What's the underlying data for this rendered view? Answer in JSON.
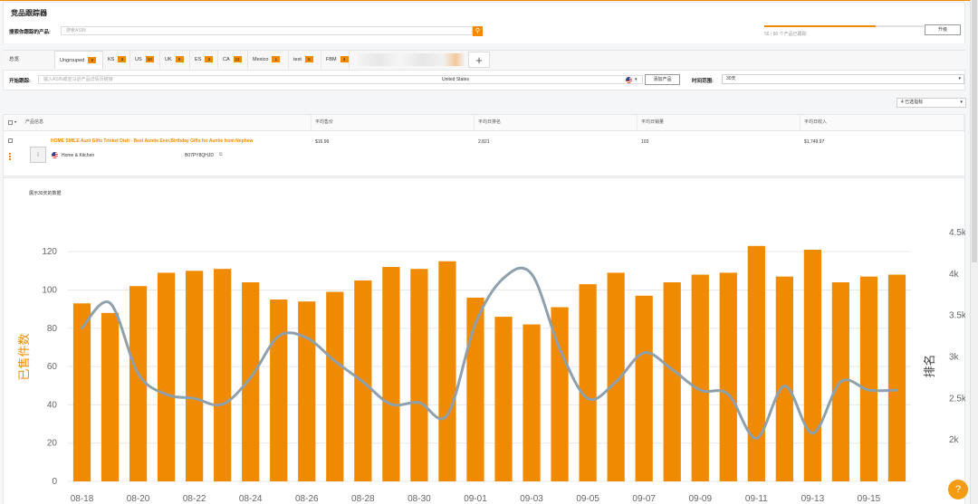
{
  "page": {
    "title": "竞品跟踪器"
  },
  "search": {
    "label": "搜索你跟踪的产品:",
    "placeholder": "搜索ASIN",
    "quota_text": "56 / 80 个产品已跟踪",
    "quota_fraction": 0.7,
    "upgrade_label": "升级"
  },
  "tabs": {
    "all_label": "总览",
    "items": [
      {
        "label": "Ungrouped",
        "count": "9"
      },
      {
        "label": "KS",
        "count": "3"
      },
      {
        "label": "US",
        "count": "10"
      },
      {
        "label": "UK",
        "count": "9"
      },
      {
        "label": "ES",
        "count": "3"
      },
      {
        "label": "CA",
        "count": "11"
      },
      {
        "label": "Mexico",
        "count": "1"
      },
      {
        "label": "test",
        "count": "6"
      },
      {
        "label": "FBM",
        "count": "4"
      }
    ],
    "add_label": "+"
  },
  "tracking": {
    "label": "开始跟踪:",
    "input_placeholder": "输入ASIN或亚马逊产品详情页链接",
    "marketplace": "United States",
    "add_button": "添加产品",
    "time_label": "时间范围:",
    "time_value": "30天",
    "selected_label": "4 已选指标"
  },
  "table": {
    "headers": [
      "产品信息",
      "平均售价",
      "平均日排名",
      "平均日销量",
      "平均日收入"
    ],
    "rows": [
      {
        "title": "HOME SMILE Aunt Gifts Trinket Dish - Best Auntie Ever,Birthday Gifts for Auntie from Nephew",
        "category": "Home & Kitchen",
        "asin": "B07PY8QHJD",
        "price": "$16.99",
        "rank": "2,821",
        "sales": "103",
        "revenue": "$1,749.97"
      }
    ]
  },
  "chart_section": {
    "caption": "展示30天的数据"
  },
  "colors": {
    "accent": "#f08a00",
    "line": "#8fa0ad"
  },
  "chart_data": {
    "type": "bar",
    "categories": [
      "08-18",
      "08-19",
      "08-20",
      "08-21",
      "08-22",
      "08-23",
      "08-24",
      "08-25",
      "08-26",
      "08-27",
      "08-28",
      "08-29",
      "08-30",
      "08-31",
      "09-01",
      "09-02",
      "09-03",
      "09-04",
      "09-05",
      "09-06",
      "09-07",
      "09-08",
      "09-09",
      "09-10",
      "09-11",
      "09-12",
      "09-13",
      "09-14",
      "09-15",
      "09-16"
    ],
    "tick_labels": [
      "08-18",
      "08-20",
      "08-22",
      "08-24",
      "08-26",
      "08-28",
      "08-30",
      "09-01",
      "09-03",
      "09-05",
      "09-07",
      "09-09",
      "09-11",
      "09-13",
      "09-15"
    ],
    "series": [
      {
        "name": "已售件数",
        "type": "bar",
        "axis": "left",
        "values": [
          93,
          88,
          102,
          109,
          110,
          111,
          104,
          95,
          94,
          99,
          105,
          112,
          111,
          115,
          96,
          86,
          82,
          91,
          103,
          109,
          97,
          104,
          108,
          109,
          123,
          107,
          121,
          104,
          107,
          108
        ]
      },
      {
        "name": "排名",
        "type": "line",
        "axis": "right",
        "values": [
          3350,
          3650,
          2800,
          2550,
          2500,
          2430,
          2750,
          3250,
          3230,
          2950,
          2700,
          2430,
          2450,
          2300,
          3400,
          3950,
          4000,
          3100,
          2500,
          2700,
          3050,
          2850,
          2600,
          2550,
          2020,
          2650,
          2080,
          2700,
          2600,
          2600
        ]
      }
    ],
    "ylabel": "已售件数",
    "y2label": "排名",
    "ylim": [
      0,
      130
    ],
    "yticks": [
      0,
      20,
      40,
      60,
      80,
      100,
      120
    ],
    "y2lim": [
      1500,
      4500
    ],
    "y2ticks": [
      "2k",
      "2.5k",
      "3k",
      "3.5k",
      "4k",
      "4.5k"
    ],
    "grid": true
  }
}
